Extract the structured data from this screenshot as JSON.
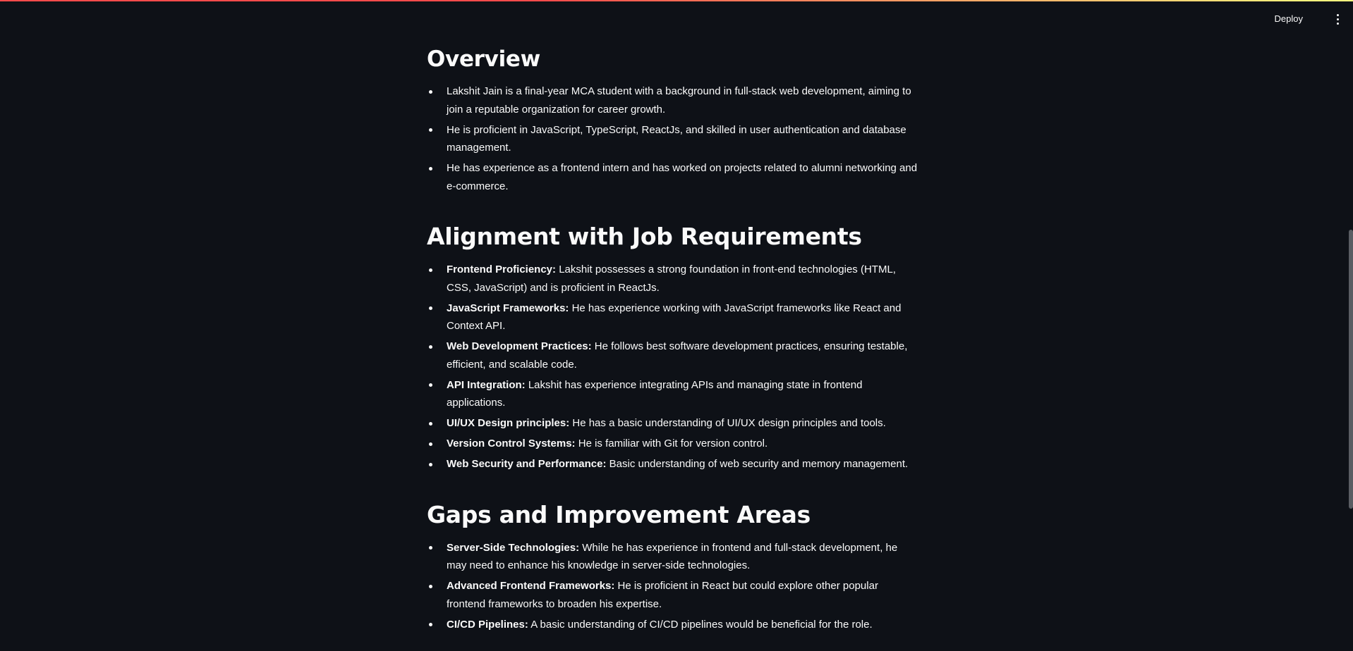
{
  "header": {
    "deploy_label": "Deploy",
    "menu_icon": "more-vertical-icon"
  },
  "colors": {
    "background": "#0e1117",
    "text": "#fafafa",
    "accent_start": "#ff4b4b",
    "accent_end": "#fffd80"
  },
  "overview": {
    "title": "Overview",
    "items": [
      {
        "text": "Lakshit Jain is a final-year MCA student with a background in full-stack web development, aiming to join a reputable organization for career growth."
      },
      {
        "text": "He is proficient in JavaScript, TypeScript, ReactJs, and skilled in user authentication and database management."
      },
      {
        "text": "He has experience as a frontend intern and has worked on projects related to alumni networking and e-commerce."
      }
    ]
  },
  "alignment": {
    "title": "Alignment with Job Requirements",
    "items": [
      {
        "label": "Frontend Proficiency:",
        "text": " Lakshit possesses a strong foundation in front-end technologies (HTML, CSS, JavaScript) and is proficient in ReactJs."
      },
      {
        "label": "JavaScript Frameworks:",
        "text": " He has experience working with JavaScript frameworks like React and Context API."
      },
      {
        "label": "Web Development Practices:",
        "text": " He follows best software development practices, ensuring testable, efficient, and scalable code."
      },
      {
        "label": "API Integration:",
        "text": " Lakshit has experience integrating APIs and managing state in frontend applications."
      },
      {
        "label": "UI/UX Design principles:",
        "text": " He has a basic understanding of UI/UX design principles and tools."
      },
      {
        "label": "Version Control Systems:",
        "text": " He is familiar with Git for version control."
      },
      {
        "label": "Web Security and Performance:",
        "text": " Basic understanding of web security and memory management."
      }
    ]
  },
  "gaps": {
    "title": "Gaps and Improvement Areas",
    "items": [
      {
        "label": "Server-Side Technologies:",
        "text": " While he has experience in frontend and full-stack development, he may need to enhance his knowledge in server-side technologies."
      },
      {
        "label": "Advanced Frontend Frameworks:",
        "text": " He is proficient in React but could explore other popular frontend frameworks to broaden his expertise."
      },
      {
        "label": "CI/CD Pipelines:",
        "text": " A basic understanding of CI/CD pipelines would be beneficial for the role."
      }
    ]
  }
}
